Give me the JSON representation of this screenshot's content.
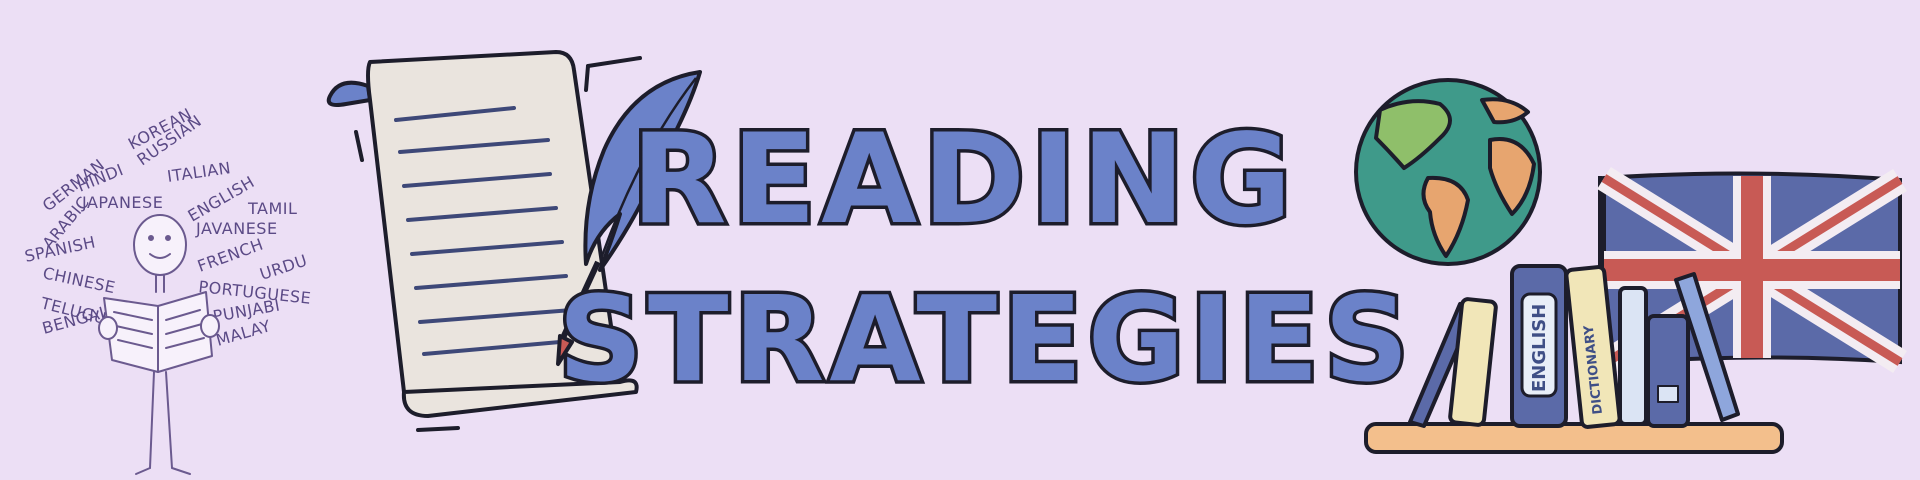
{
  "title": {
    "line1": "READING",
    "line2": "STRATEGIES"
  },
  "languages": [
    "KOREAN",
    "GERMAN",
    "HINDI",
    "RUSSIAN",
    "ITALIAN",
    "JAPANESE",
    "ENGLISH",
    "TAMIL",
    "ARABIC",
    "SPANISH",
    "JAVANESE",
    "FRENCH",
    "URDU",
    "CHINESE",
    "PORTUGUESE",
    "BENGALI",
    "TELUGU",
    "PUNJABI",
    "MALAY"
  ],
  "books": {
    "english_label": "ENGLISH",
    "dictionary_label": "DICTIONARY"
  },
  "colors": {
    "background": "#ecdff5",
    "title_fill": "#6b82c9",
    "outline": "#1d1d2b",
    "flag_blue": "#5b6aa8",
    "flag_red": "#c85a55",
    "shelf": "#f3bf8c"
  },
  "icons": [
    "reader-figure",
    "scroll-icon",
    "quill-icon",
    "globe-icon",
    "union-jack-flag",
    "bookshelf-icon"
  ]
}
